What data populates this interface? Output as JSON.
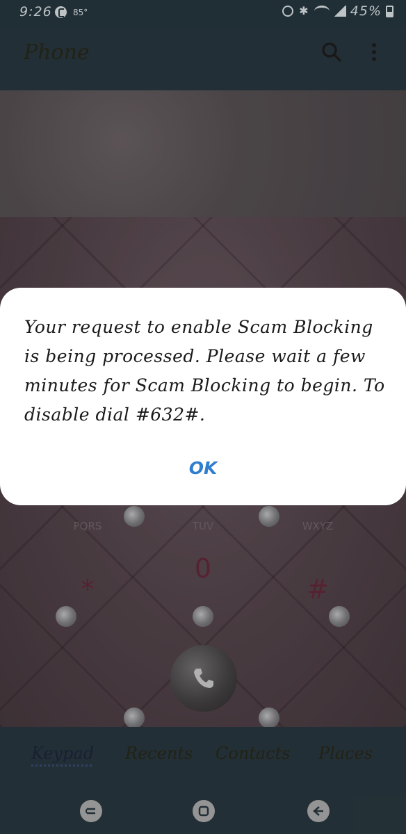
{
  "status_bar": {
    "time": "9:26",
    "temperature": "85°",
    "battery": "45%",
    "icons": [
      "call-icon",
      "alarm-icon",
      "bluetooth-icon",
      "wifi-icon",
      "signal-icon",
      "battery-icon"
    ]
  },
  "app_bar": {
    "title": "Phone",
    "actions": [
      "search-icon",
      "more-options-icon"
    ]
  },
  "keypad": {
    "letters": [
      "PQRS",
      "TUV",
      "WXYZ"
    ],
    "keys": [
      "*",
      "0",
      "#"
    ],
    "zero_sub": "+"
  },
  "dialog": {
    "message": "Your request to enable Scam Blocking is being processed.  Please wait a few minutes for Scam Blocking to begin. To disable dial #632#.",
    "ok_label": "OK"
  },
  "tabs": [
    {
      "label": "Keypad",
      "active": true
    },
    {
      "label": "Recents",
      "active": false
    },
    {
      "label": "Contacts",
      "active": false
    },
    {
      "label": "Places",
      "active": false
    }
  ],
  "nav_bar": [
    "recent-apps-icon",
    "home-icon",
    "back-icon"
  ],
  "colors": {
    "accent": "#2f7ed0",
    "bar_background": "#2b3a42",
    "dialog_background": "#ffffff"
  }
}
